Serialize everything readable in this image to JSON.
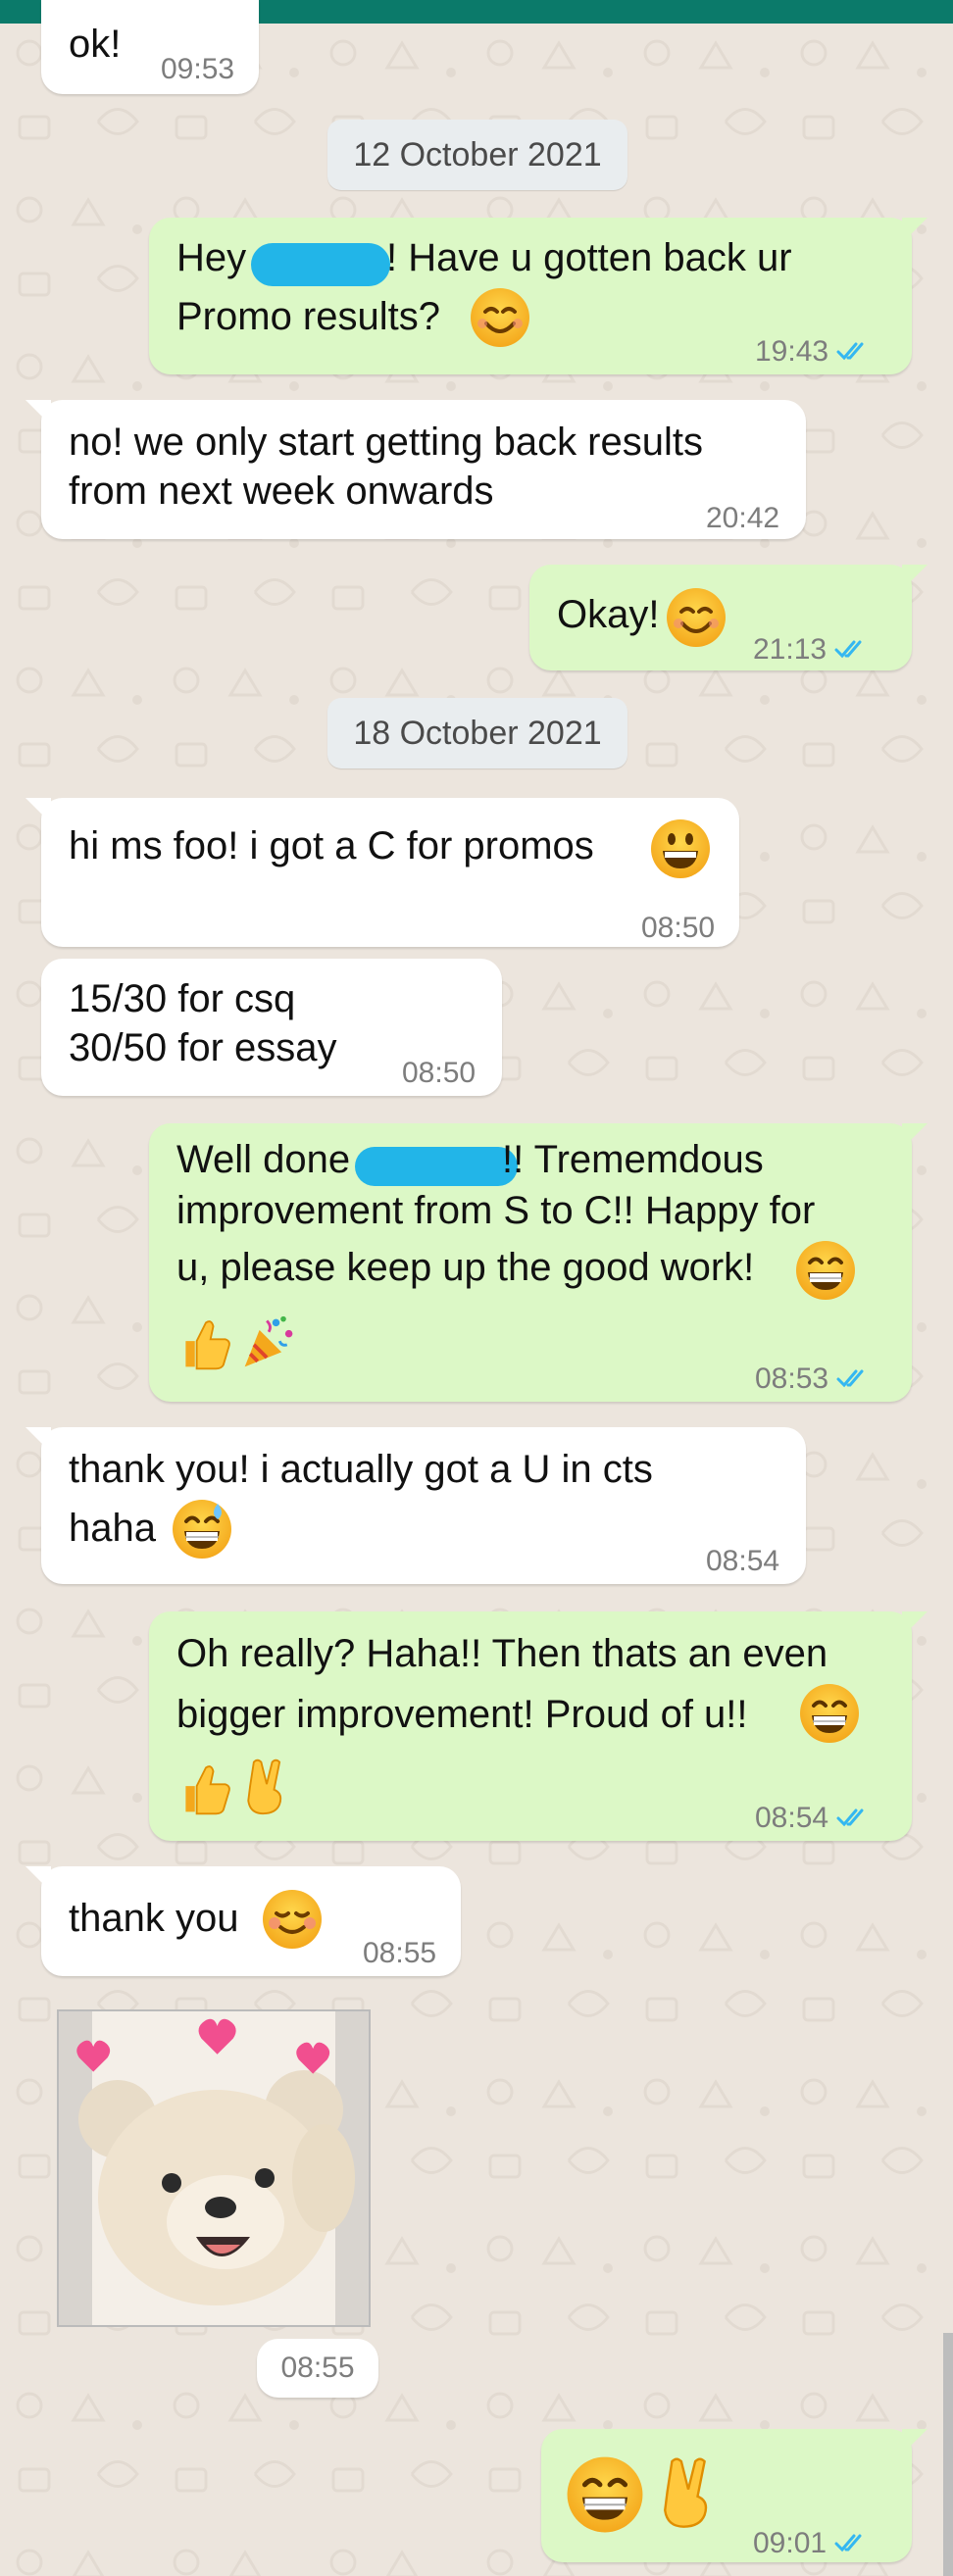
{
  "colors": {
    "accent": "#0b7a6a",
    "incoming": "#ffffff",
    "outgoing": "#dcf8c6",
    "tick_blue": "#34b7f1"
  },
  "dates": [
    "12 October 2021",
    "18 October 2021"
  ],
  "messages": [
    {
      "lines": [
        "ok!"
      ],
      "time": "09:53",
      "direction": "in"
    },
    {
      "lines": [
        "Hey ",
        "! Have u gotten back ur",
        "Promo results?"
      ],
      "time": "19:43",
      "direction": "out"
    },
    {
      "lines": [
        "no! we only start getting back results",
        "from next week onwards"
      ],
      "time": "20:42",
      "direction": "in"
    },
    {
      "lines": [
        "Okay!"
      ],
      "time": "21:13",
      "direction": "out"
    },
    {
      "lines": [
        "hi ms foo! i got a C for promos"
      ],
      "time": "08:50",
      "direction": "in"
    },
    {
      "lines": [
        "15/30 for csq",
        "30/50 for essay"
      ],
      "time": "08:50",
      "direction": "in"
    },
    {
      "lines": [
        "Well done",
        "!! Trememdous",
        "improvement from S to C!! Happy for",
        "u, please keep up the good work!"
      ],
      "time": "08:53",
      "direction": "out"
    },
    {
      "lines": [
        "thank you! i actually got a U in cts",
        "haha"
      ],
      "time": "08:54",
      "direction": "in"
    },
    {
      "lines": [
        "Oh really? Haha!! Then thats an even",
        "bigger improvement! Proud of u!!"
      ],
      "time": "08:54",
      "direction": "out"
    },
    {
      "lines": [
        "thank you"
      ],
      "time": "08:55",
      "direction": "in"
    },
    {
      "lines": [],
      "time": "08:55",
      "direction": "in",
      "kind": "sticker"
    },
    {
      "lines": [],
      "time": "09:01",
      "direction": "out"
    }
  ],
  "icons": [
    "smiling-face-emoji",
    "grinning-face-emoji",
    "beaming-face-emoji",
    "grinning-sweat-emoji",
    "thumbs-up-emoji",
    "party-popper-emoji",
    "victory-hand-emoji",
    "blushing-face-emoji",
    "double-check-icon",
    "teddy-bear-sticker"
  ]
}
